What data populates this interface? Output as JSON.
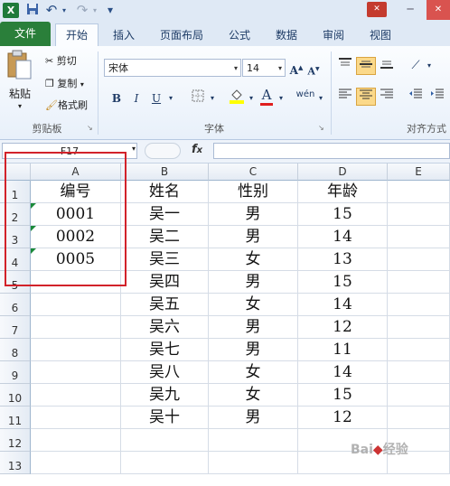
{
  "window": {
    "minimize_glyph": "─",
    "close_glyph": "✕"
  },
  "qat": {
    "save_icon": "save-icon",
    "undo_glyph": "↶",
    "redo_glyph": "↷",
    "customize_glyph": "▾"
  },
  "tabs": [
    {
      "label": "文件"
    },
    {
      "label": "开始"
    },
    {
      "label": "插入"
    },
    {
      "label": "页面布局"
    },
    {
      "label": "公式"
    },
    {
      "label": "数据"
    },
    {
      "label": "审阅"
    },
    {
      "label": "视图"
    }
  ],
  "ribbon": {
    "clipboard": {
      "paste": "粘贴",
      "cut": "剪切",
      "copy": "复制",
      "format_painter": "格式刷",
      "group": "剪贴板"
    },
    "font": {
      "family": "宋体",
      "size": "14",
      "bold": "B",
      "italic": "I",
      "underline": "U",
      "group": "字体",
      "grow": "A",
      "shrink": "A",
      "phonetic": "wén"
    },
    "align": {
      "group": "对齐方式"
    }
  },
  "formula_bar": {
    "name_box": "F17",
    "fx": "fx",
    "formula": ""
  },
  "columns": [
    "A",
    "B",
    "C",
    "D",
    "E"
  ],
  "rows": [
    "1",
    "2",
    "3",
    "4",
    "5",
    "6",
    "7",
    "8",
    "9",
    "10",
    "11",
    "12",
    "13"
  ],
  "sheet": {
    "A": [
      "编号",
      "0001",
      "0002",
      "0005",
      "",
      "",
      "",
      "",
      "",
      "",
      "",
      "",
      ""
    ],
    "B": [
      "姓名",
      "吴一",
      "吴二",
      "吴三",
      "吴四",
      "吴五",
      "吴六",
      "吴七",
      "吴八",
      "吴九",
      "吴十",
      "",
      ""
    ],
    "C": [
      "性别",
      "男",
      "男",
      "女",
      "男",
      "女",
      "男",
      "男",
      "女",
      "女",
      "男",
      "",
      ""
    ],
    "D": [
      "年龄",
      "15",
      "14",
      "13",
      "15",
      "14",
      "12",
      "11",
      "14",
      "15",
      "12",
      "",
      ""
    ]
  },
  "colors": {
    "file_tab": "#2a7f3a",
    "highlight_box": "#d2222a",
    "text_marker": "#1b8a3a"
  }
}
